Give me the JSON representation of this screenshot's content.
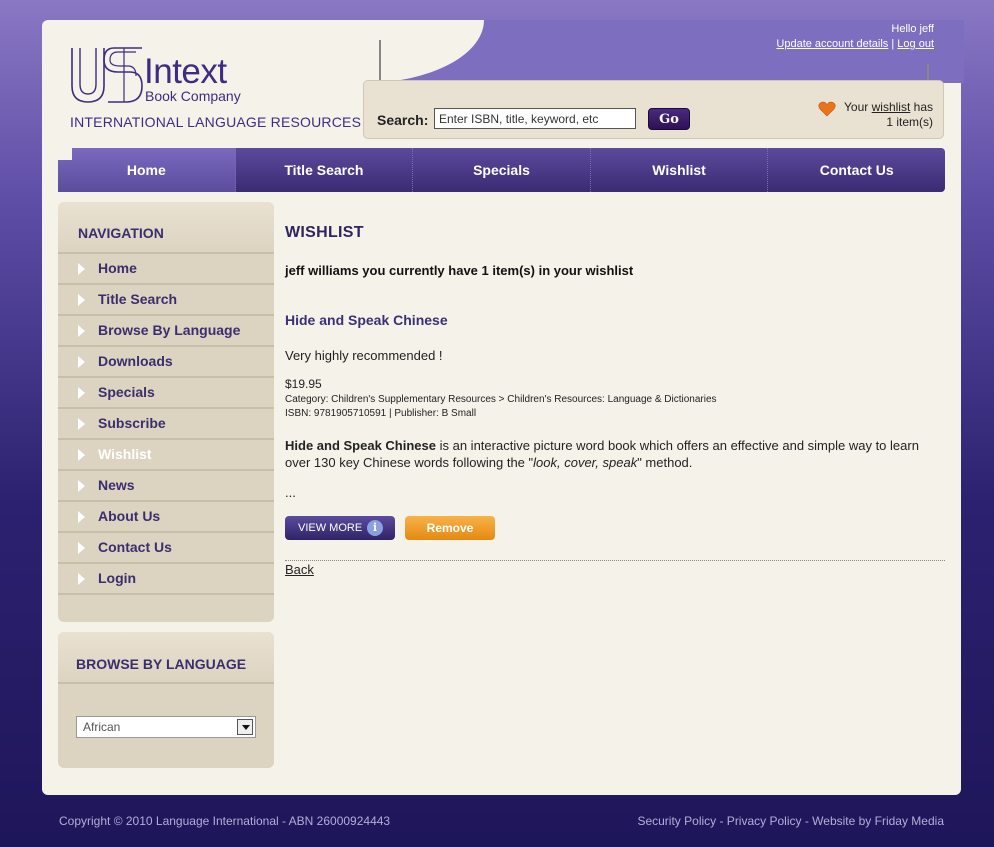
{
  "brand": {
    "logo_word": "Intext",
    "logo_sub": "Book Company",
    "tagline": "INTERNATIONAL LANGUAGE RESOURCES"
  },
  "user": {
    "greeting": "Hello jeff",
    "update_link": "Update account details",
    "separator": "|",
    "logout_link": "Log out"
  },
  "search": {
    "label": "Search:",
    "placeholder": "Enter ISBN, title, keyword, etc",
    "go_label": "Go"
  },
  "wishlist_summary": {
    "prefix": "Your",
    "link": "wishlist",
    "suffix": "has",
    "count_text": "1 item(s)"
  },
  "nav": {
    "items": [
      {
        "label": "Home",
        "active": true
      },
      {
        "label": "Title Search"
      },
      {
        "label": "Specials"
      },
      {
        "label": "Wishlist"
      },
      {
        "label": "Contact Us"
      }
    ]
  },
  "sidebar": {
    "heading": "NAVIGATION",
    "items": [
      {
        "label": "Home"
      },
      {
        "label": "Title Search"
      },
      {
        "label": "Browse By Language"
      },
      {
        "label": "Downloads"
      },
      {
        "label": "Specials"
      },
      {
        "label": "Subscribe"
      },
      {
        "label": "Wishlist",
        "active": true
      },
      {
        "label": "News"
      },
      {
        "label": "About Us"
      },
      {
        "label": "Contact Us"
      },
      {
        "label": "Login"
      }
    ],
    "language_heading": "BROWSE BY LANGUAGE",
    "language_selected": "African"
  },
  "main": {
    "title": "WISHLIST",
    "message": "jeff williams you currently have 1 item(s) in your wishlist",
    "book": {
      "title": "Hide and Speak Chinese",
      "recommendation": "Very highly recommended !",
      "price": "$19.95",
      "category": "Category: Children's Supplementary Resources > Children's Resources: Language & Dictionaries",
      "isbn_publisher": "ISBN: 9781905710591 | Publisher: B Small",
      "desc_bold": "Hide and Speak Chinese",
      "desc_1": " is an interactive picture word book which offers an effective and simple way to learn over 130 key Chinese words following the \"",
      "desc_italic": "look, cover, speak",
      "desc_2": "\" method.",
      "ellipsis": "...",
      "view_more": "VIEW MORE",
      "info_glyph": "i",
      "remove": "Remove"
    },
    "back": "Back"
  },
  "footer": {
    "copyright": "Copyright © 2010 Language International - ABN 26000924443",
    "links": "Security Policy - Privacy Policy - Website by Friday Media"
  },
  "colors": {
    "brand_purple": "#3b2e82",
    "nav_purple": "#3a2b74",
    "sidebar_bg": "#ddd3c1",
    "remove_orange": "#e58a10",
    "page_bg": "#f5f2ea"
  }
}
